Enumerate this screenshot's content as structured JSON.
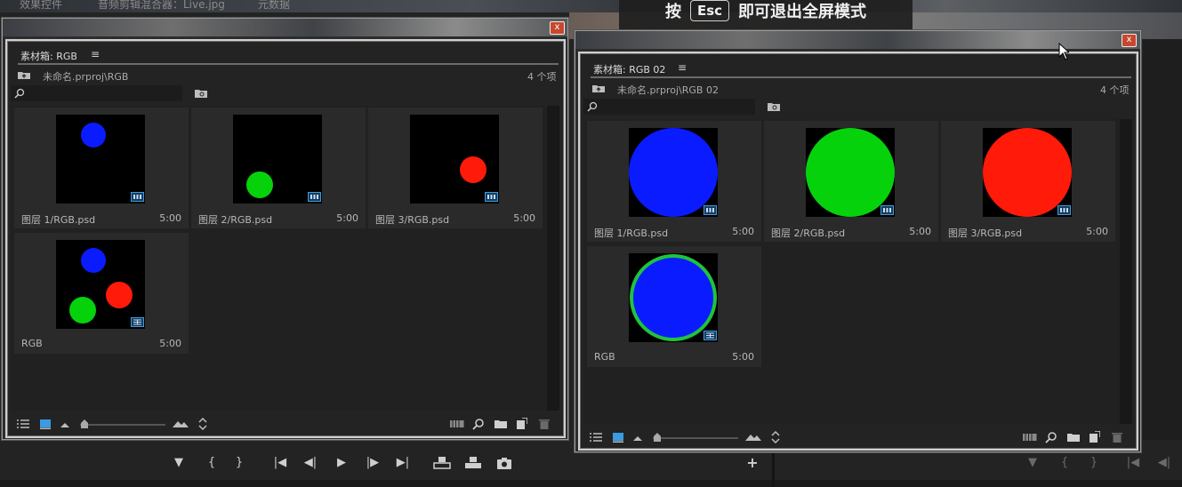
{
  "background_app": {
    "top_tabs": [
      "效果控件",
      "音频剪辑混合器：Live.jpg",
      "元数据"
    ],
    "fullscreen_toast": {
      "prefix": "按",
      "key": "Esc",
      "suffix": "即可退出全屏模式"
    },
    "transport_icons": [
      "marker-icon",
      "mark-in-icon",
      "mark-out-icon",
      "go-to-in-icon",
      "step-back-icon",
      "play-icon",
      "step-forward-icon",
      "go-to-out-icon",
      "insert-icon",
      "overwrite-icon",
      "export-frame-icon",
      "add-button-icon"
    ],
    "transport_glyphs": {
      "marker": "▼",
      "mark_in": "{",
      "mark_out": "}",
      "go_to_in": "|◀",
      "step_back": "◀|",
      "play": "▶",
      "step_forward": "|▶",
      "go_to_out": "▶|",
      "add": "+"
    }
  },
  "bins": [
    {
      "tab_title": "素材箱: RGB",
      "menu_glyph": "≡",
      "breadcrumb": "未命名.prproj\\RGB",
      "item_count": "4 个项",
      "close_glyph": "x",
      "items": [
        {
          "name": "图层 1/RGB.psd",
          "duration": "5:00",
          "circles": [
            {
              "color": "#0a1cff",
              "label": "blue"
            }
          ]
        },
        {
          "name": "图层 2/RGB.psd",
          "duration": "5:00",
          "circles": [
            {
              "color": "#06d20c",
              "label": "green"
            }
          ]
        },
        {
          "name": "图层 3/RGB.psd",
          "duration": "5:00",
          "circles": [
            {
              "color": "#ff1a0a",
              "label": "red"
            }
          ]
        },
        {
          "name": "RGB",
          "duration": "5:00",
          "circles": [
            {
              "color": "#0a1cff"
            },
            {
              "color": "#06d20c"
            },
            {
              "color": "#ff1a0a"
            }
          ]
        }
      ]
    },
    {
      "tab_title": "素材箱: RGB 02",
      "menu_glyph": "≡",
      "breadcrumb": "未命名.prproj\\RGB 02",
      "item_count": "4 个项",
      "close_glyph": "x",
      "items": [
        {
          "name": "图层 1/RGB.psd",
          "duration": "5:00",
          "circles": [
            {
              "color": "#0a1cff"
            }
          ]
        },
        {
          "name": "图层 2/RGB.psd",
          "duration": "5:00",
          "circles": [
            {
              "color": "#06d20c"
            }
          ]
        },
        {
          "name": "图层 3/RGB.psd",
          "duration": "5:00",
          "circles": [
            {
              "color": "#ff1a0a"
            }
          ]
        },
        {
          "name": "RGB",
          "duration": "5:00",
          "circles": [
            {
              "color": "#0a1cff",
              "stroke": "#1fc43a"
            }
          ]
        }
      ]
    }
  ],
  "colors": {
    "accent": "#3a9be0",
    "panel_border": "#d0d0d0",
    "close_button": "#c8472d"
  }
}
